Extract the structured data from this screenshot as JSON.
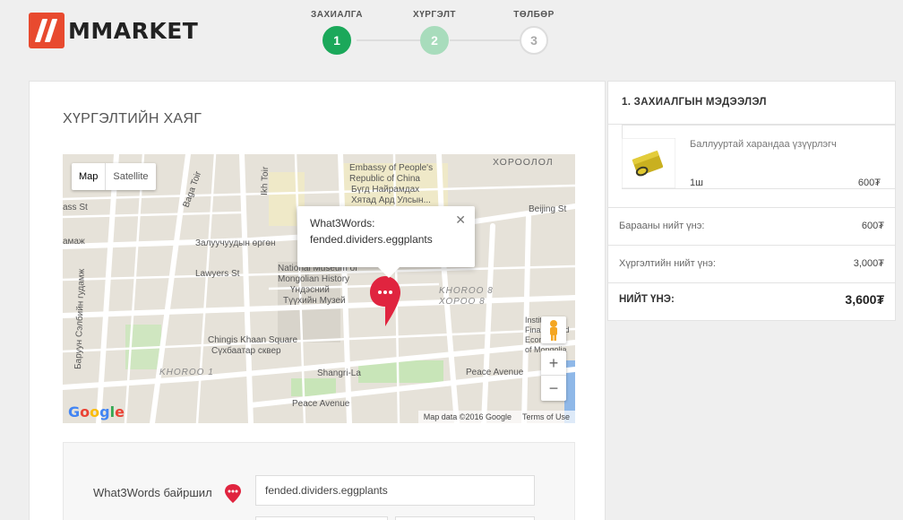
{
  "brand": {
    "name": "MMARKET",
    "accent": "#e84a2f"
  },
  "steps": [
    {
      "label": "ЗАХИАЛГА",
      "number": "1",
      "state": "active"
    },
    {
      "label": "ХҮРГЭЛТ",
      "number": "2",
      "state": "next"
    },
    {
      "label": "ТӨЛБӨР",
      "number": "3",
      "state": "todo"
    }
  ],
  "main": {
    "title": "ХҮРГЭЛТИЙН ХАЯГ",
    "map": {
      "type_map": "Map",
      "type_satellite": "Satellite",
      "info_title": "What3Words:",
      "info_address": "fended.dividers.eggplants",
      "zoom_in": "+",
      "zoom_out": "−",
      "attribution": "Map data ©2016 Google",
      "terms": "Terms of Use",
      "labels": {
        "embassy1": "Embassy of People's",
        "embassy2": "Republic of China",
        "embassy3": "Бүгд Найрамдах",
        "embassy4": "Хятад Ард Улсын...",
        "khoroolol": "ХОРООЛОЛ",
        "beijing": "Beijing St",
        "zaluuchuud": "Залуучуудын өргөн",
        "lawyers": "Lawyers St",
        "museum1": "National Museum of",
        "museum2": "Mongolian History",
        "museum3": "Үндэсний",
        "museum4": "Түүхийн Музей",
        "khoroo8a": "KHOROO 8",
        "khoroo8b": "ХОРОО 8",
        "chinggis1": "Chingis Khaan Square",
        "chinggis2": "Сүхбаатар сквер",
        "khoroo1": "KHOROO 1",
        "shangri": "Shangri-La",
        "peace1": "Peace Avenue",
        "peace2": "Peace Avenue",
        "baga": "Baga Toir",
        "ikh": "Ikh Toir",
        "baruun": "Баруун Сэлбийн гудамж",
        "inst1": "Institute of",
        "inst2": "Finance and",
        "inst3": "Economics",
        "inst4": "of Mongolia",
        "amaj": "амаж",
        "ass": "ass St"
      }
    },
    "w3w_label": "What3Words байршил",
    "w3w_value": "fended.dividers.eggplants"
  },
  "sidebar": {
    "heading": "1. ЗАХИАЛГЫН МЭДЭЭЛЭЛ",
    "product": {
      "name": "Баллууртай харандаа үзүүрлэгч",
      "qty": "1ш",
      "price": "600₮"
    },
    "rows": [
      {
        "label": "Барааны нийт үнэ:",
        "value": "600₮"
      },
      {
        "label": "Хүргэлтийн нийт үнэ:",
        "value": "3,000₮"
      },
      {
        "label": "НИЙТ ҮНЭ:",
        "value": "3,600₮"
      }
    ]
  }
}
